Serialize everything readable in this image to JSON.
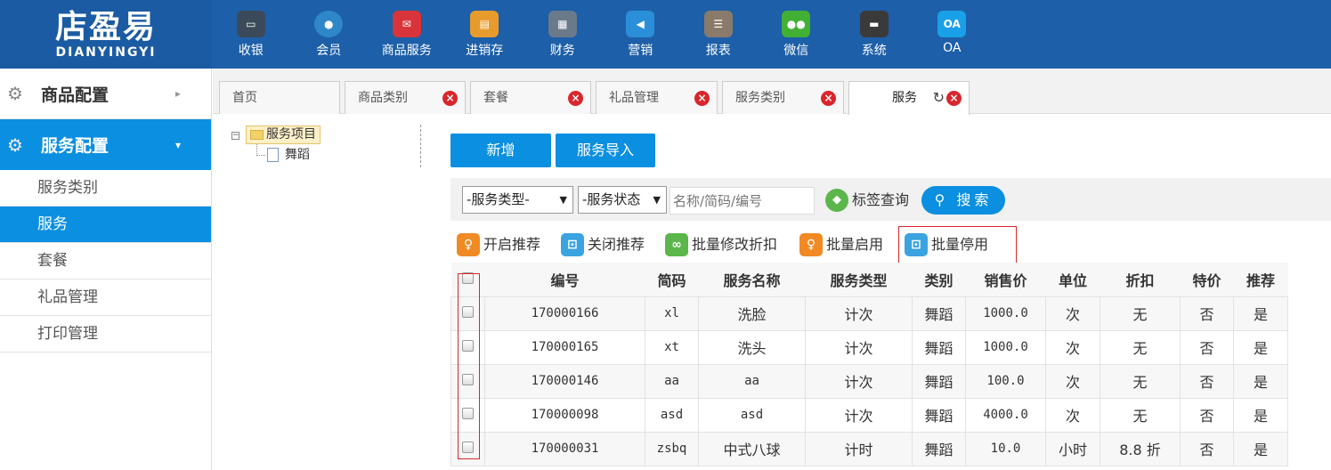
{
  "logo": {
    "cn": "店盈易",
    "en": "DIANYINGYI"
  },
  "nav": [
    {
      "label": "收银",
      "icon": "cash-register-icon",
      "color": "#3a4a5a"
    },
    {
      "label": "会员",
      "icon": "member-icon",
      "color": "#2f86c9"
    },
    {
      "label": "商品服务",
      "icon": "product-service-icon",
      "color": "#d8343a"
    },
    {
      "label": "进销存",
      "icon": "inventory-icon",
      "color": "#e89b2d"
    },
    {
      "label": "财务",
      "icon": "finance-icon",
      "color": "#6a7a8a"
    },
    {
      "label": "营销",
      "icon": "megaphone-icon",
      "color": "#2a8fd8"
    },
    {
      "label": "报表",
      "icon": "report-icon",
      "color": "#8a7a6a"
    },
    {
      "label": "微信",
      "icon": "wechat-icon",
      "color": "#41b035"
    },
    {
      "label": "系统",
      "icon": "monitor-icon",
      "color": "#3a3a3a"
    },
    {
      "label": "OA",
      "icon": "oa-icon",
      "color": "#1aa0e8",
      "text": "OA"
    }
  ],
  "sidebar": {
    "groups": [
      {
        "label": "商品配置",
        "expanded": false
      },
      {
        "label": "服务配置",
        "expanded": true
      }
    ],
    "items": [
      "服务类别",
      "服务",
      "套餐",
      "礼品管理",
      "打印管理"
    ],
    "active": "服务"
  },
  "tabs": [
    "首页",
    "商品类别",
    "套餐",
    "礼品管理",
    "服务类别",
    "服务"
  ],
  "tree": {
    "root": "服务项目",
    "children": [
      "舞蹈"
    ]
  },
  "buttons": {
    "add": "新增",
    "import": "服务导入"
  },
  "filters": {
    "type_select": "-服务类型-",
    "status_select": "-服务状态",
    "name_placeholder": "名称/简码/编号",
    "tag_query": "标签查询",
    "search": "搜索"
  },
  "actions": [
    "开启推荐",
    "关闭推荐",
    "批量修改折扣",
    "批量启用",
    "批量停用"
  ],
  "table": {
    "headers": [
      "编号",
      "简码",
      "服务名称",
      "服务类型",
      "类别",
      "销售价",
      "单位",
      "折扣",
      "特价",
      "推荐"
    ],
    "rows": [
      [
        "170000166",
        "xl",
        "洗脸",
        "计次",
        "舞蹈",
        "1000.0",
        "次",
        "无",
        "否",
        "是"
      ],
      [
        "170000165",
        "xt",
        "洗头",
        "计次",
        "舞蹈",
        "1000.0",
        "次",
        "无",
        "否",
        "是"
      ],
      [
        "170000146",
        "aa",
        "aa",
        "计次",
        "舞蹈",
        "100.0",
        "次",
        "无",
        "否",
        "是"
      ],
      [
        "170000098",
        "asd",
        "asd",
        "计次",
        "舞蹈",
        "4000.0",
        "次",
        "无",
        "否",
        "是"
      ],
      [
        "170000031",
        "zsbq",
        "中式八球",
        "计时",
        "舞蹈",
        "10.0",
        "小时",
        "8.8 折",
        "否",
        "是"
      ]
    ]
  },
  "colors": {
    "primary": "#0b8fe0",
    "topbar": "#1d5fa8",
    "highlight_border": "#d9262c"
  }
}
